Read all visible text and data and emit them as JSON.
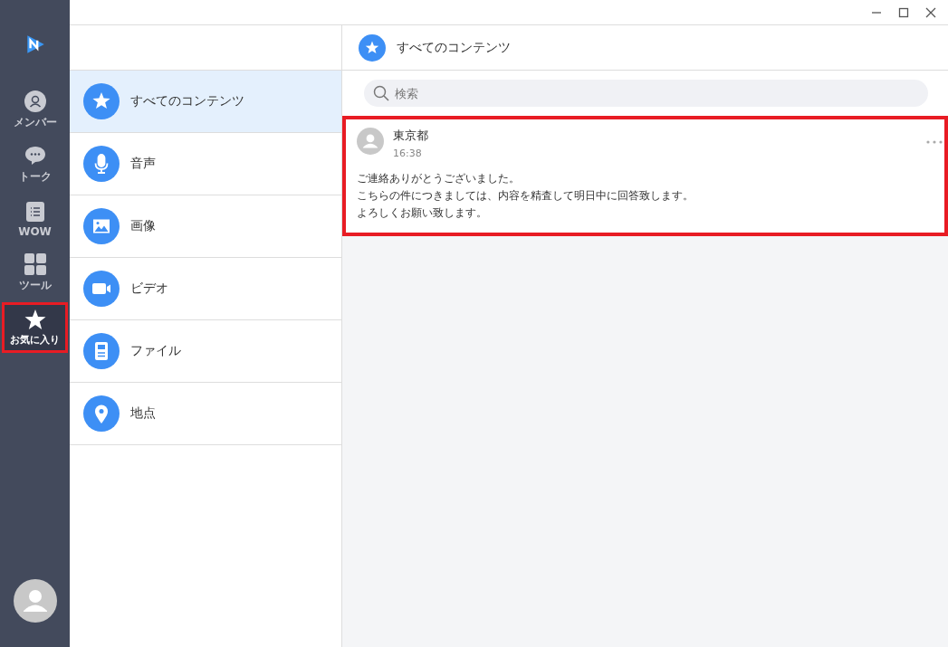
{
  "nav": [
    {
      "label": "メンバー",
      "selected": false,
      "highlighted": false
    },
    {
      "label": "トーク",
      "selected": false,
      "highlighted": false
    },
    {
      "label": "WOW",
      "selected": false,
      "highlighted": false
    },
    {
      "label": "ツール",
      "selected": false,
      "highlighted": false
    },
    {
      "label": "お気に入り",
      "selected": true,
      "highlighted": true
    }
  ],
  "categories": [
    {
      "label": "すべてのコンテンツ",
      "selected": true
    },
    {
      "label": "音声",
      "selected": false
    },
    {
      "label": "画像",
      "selected": false
    },
    {
      "label": "ビデオ",
      "selected": false
    },
    {
      "label": "ファイル",
      "selected": false
    },
    {
      "label": "地点",
      "selected": false
    }
  ],
  "content": {
    "title": "すべてのコンテンツ",
    "search": {
      "placeholder": "検索"
    },
    "messages": [
      {
        "sender": "東京都",
        "time": "16:38",
        "highlighted": true,
        "lines": [
          "ご連絡ありがとうございました。",
          "こちらの件につきましては、内容を精査して明日中に回答致します。",
          "よろしくお願い致します。"
        ]
      }
    ]
  }
}
